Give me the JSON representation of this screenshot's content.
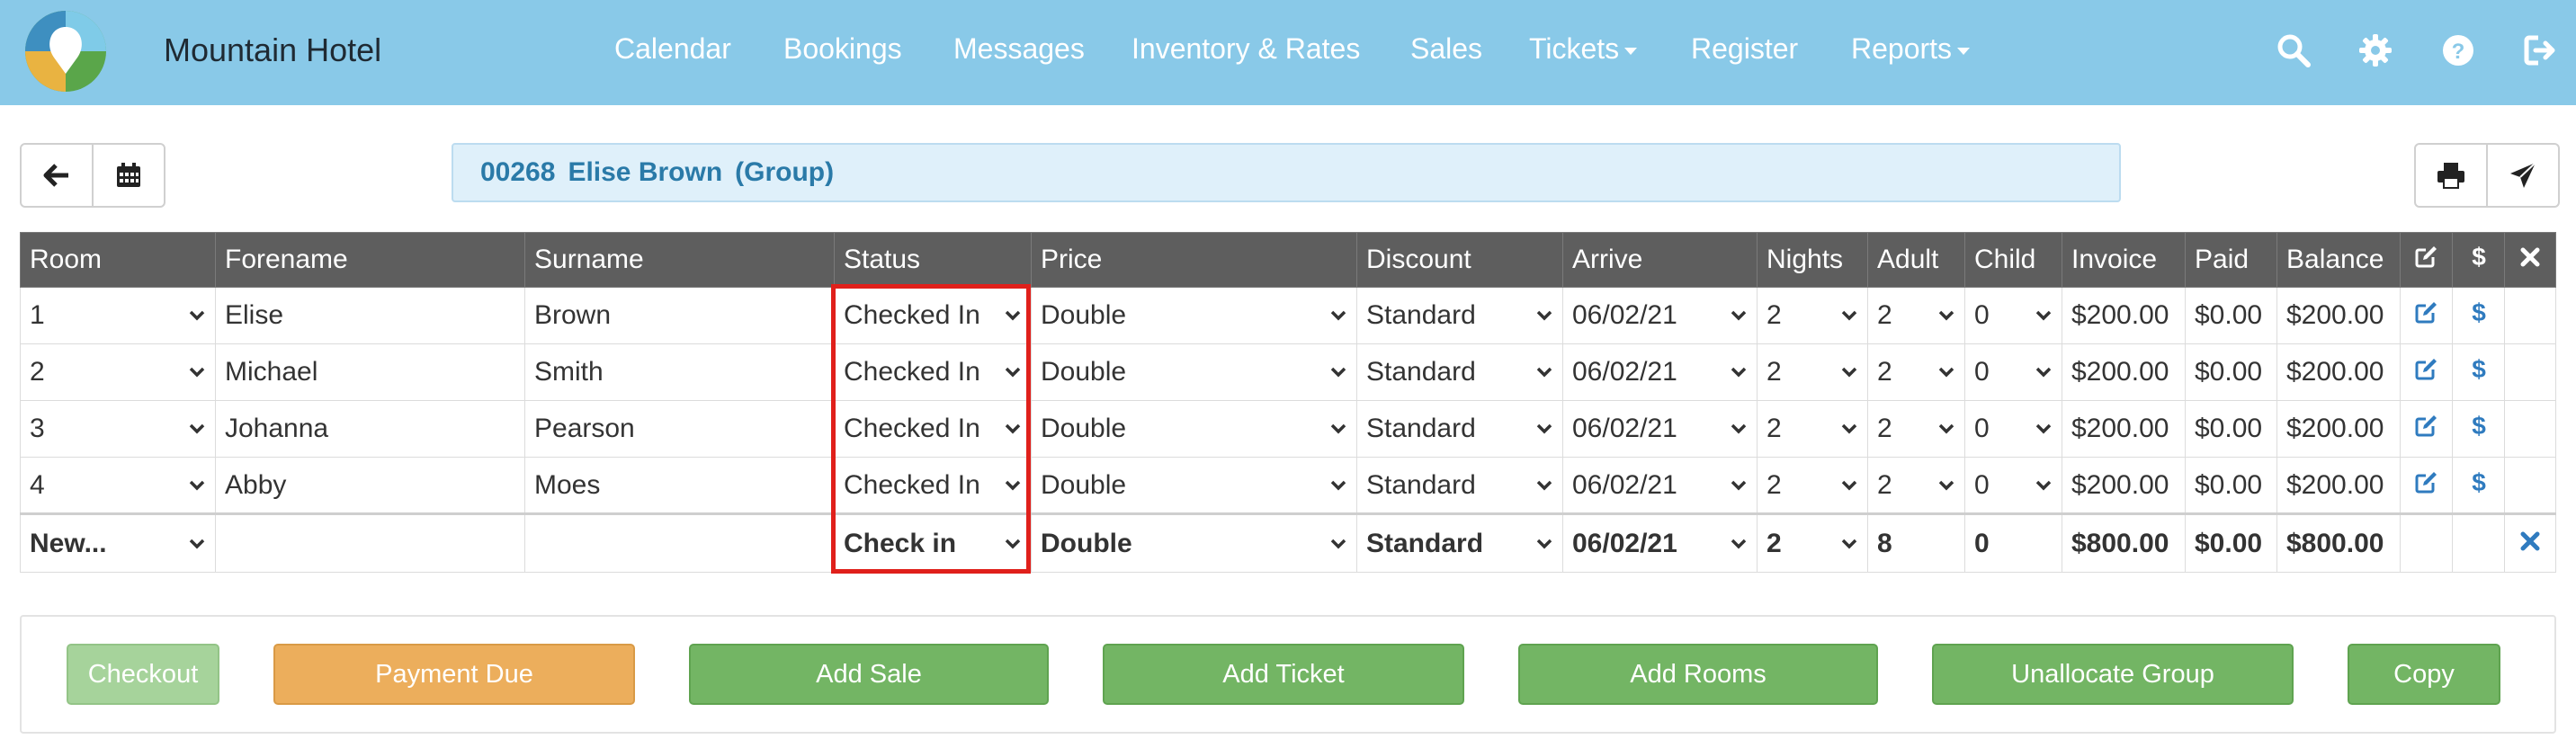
{
  "app": {
    "brand": "Mountain Hotel",
    "colors": {
      "navbar": "#89c9e8",
      "accent_link": "#2f7bbf",
      "highlight": "#e0201b"
    }
  },
  "nav": {
    "items": [
      {
        "label": "Calendar"
      },
      {
        "label": "Bookings"
      },
      {
        "label": "Messages"
      },
      {
        "label": "Inventory & Rates"
      },
      {
        "label": "Sales"
      },
      {
        "label": "Tickets",
        "dropdown": true
      },
      {
        "label": "Register"
      },
      {
        "label": "Reports",
        "dropdown": true
      }
    ],
    "icons": [
      "search-icon",
      "gear-icon",
      "help-icon",
      "logout-icon"
    ]
  },
  "toolbar": {
    "left_icons": [
      "arrow-left-icon",
      "calendar-icon"
    ],
    "right_icons": [
      "print-icon",
      "send-icon"
    ]
  },
  "booking": {
    "number": "00268",
    "name": "Elise Brown",
    "type": "(Group)"
  },
  "table": {
    "headers": [
      "Room",
      "Forename",
      "Surname",
      "Status",
      "Price",
      "Discount",
      "Arrive",
      "Nights",
      "Adult",
      "Child",
      "Invoice",
      "Paid",
      "Balance"
    ],
    "header_icons": [
      "edit-icon",
      "dollar-icon",
      "close-icon"
    ],
    "rows": [
      {
        "room": "1",
        "forename": "Elise",
        "surname": "Brown",
        "status": "Checked In",
        "price": "Double",
        "discount": "Standard",
        "arrive": "06/02/21",
        "nights": "2",
        "adult": "2",
        "child": "0",
        "invoice": "$200.00",
        "paid": "$0.00",
        "balance": "$200.00"
      },
      {
        "room": "2",
        "forename": "Michael",
        "surname": "Smith",
        "status": "Checked In",
        "price": "Double",
        "discount": "Standard",
        "arrive": "06/02/21",
        "nights": "2",
        "adult": "2",
        "child": "0",
        "invoice": "$200.00",
        "paid": "$0.00",
        "balance": "$200.00"
      },
      {
        "room": "3",
        "forename": "Johanna",
        "surname": "Pearson",
        "status": "Checked In",
        "price": "Double",
        "discount": "Standard",
        "arrive": "06/02/21",
        "nights": "2",
        "adult": "2",
        "child": "0",
        "invoice": "$200.00",
        "paid": "$0.00",
        "balance": "$200.00"
      },
      {
        "room": "4",
        "forename": "Abby",
        "surname": "Moes",
        "status": "Checked In",
        "price": "Double",
        "discount": "Standard",
        "arrive": "06/02/21",
        "nights": "2",
        "adult": "2",
        "child": "0",
        "invoice": "$200.00",
        "paid": "$0.00",
        "balance": "$200.00"
      }
    ],
    "new_row": {
      "room": "New...",
      "status": "Check in",
      "price": "Double",
      "discount": "Standard",
      "arrive": "06/02/21",
      "nights": "2",
      "adult": "8",
      "child": "0",
      "invoice": "$800.00",
      "paid": "$0.00",
      "balance": "$800.00"
    }
  },
  "actions": {
    "checkout": "Checkout",
    "payment_due": "Payment Due",
    "add_sale": "Add Sale",
    "add_ticket": "Add Ticket",
    "add_rooms": "Add Rooms",
    "unallocate_group": "Unallocate Group",
    "copy": "Copy"
  }
}
